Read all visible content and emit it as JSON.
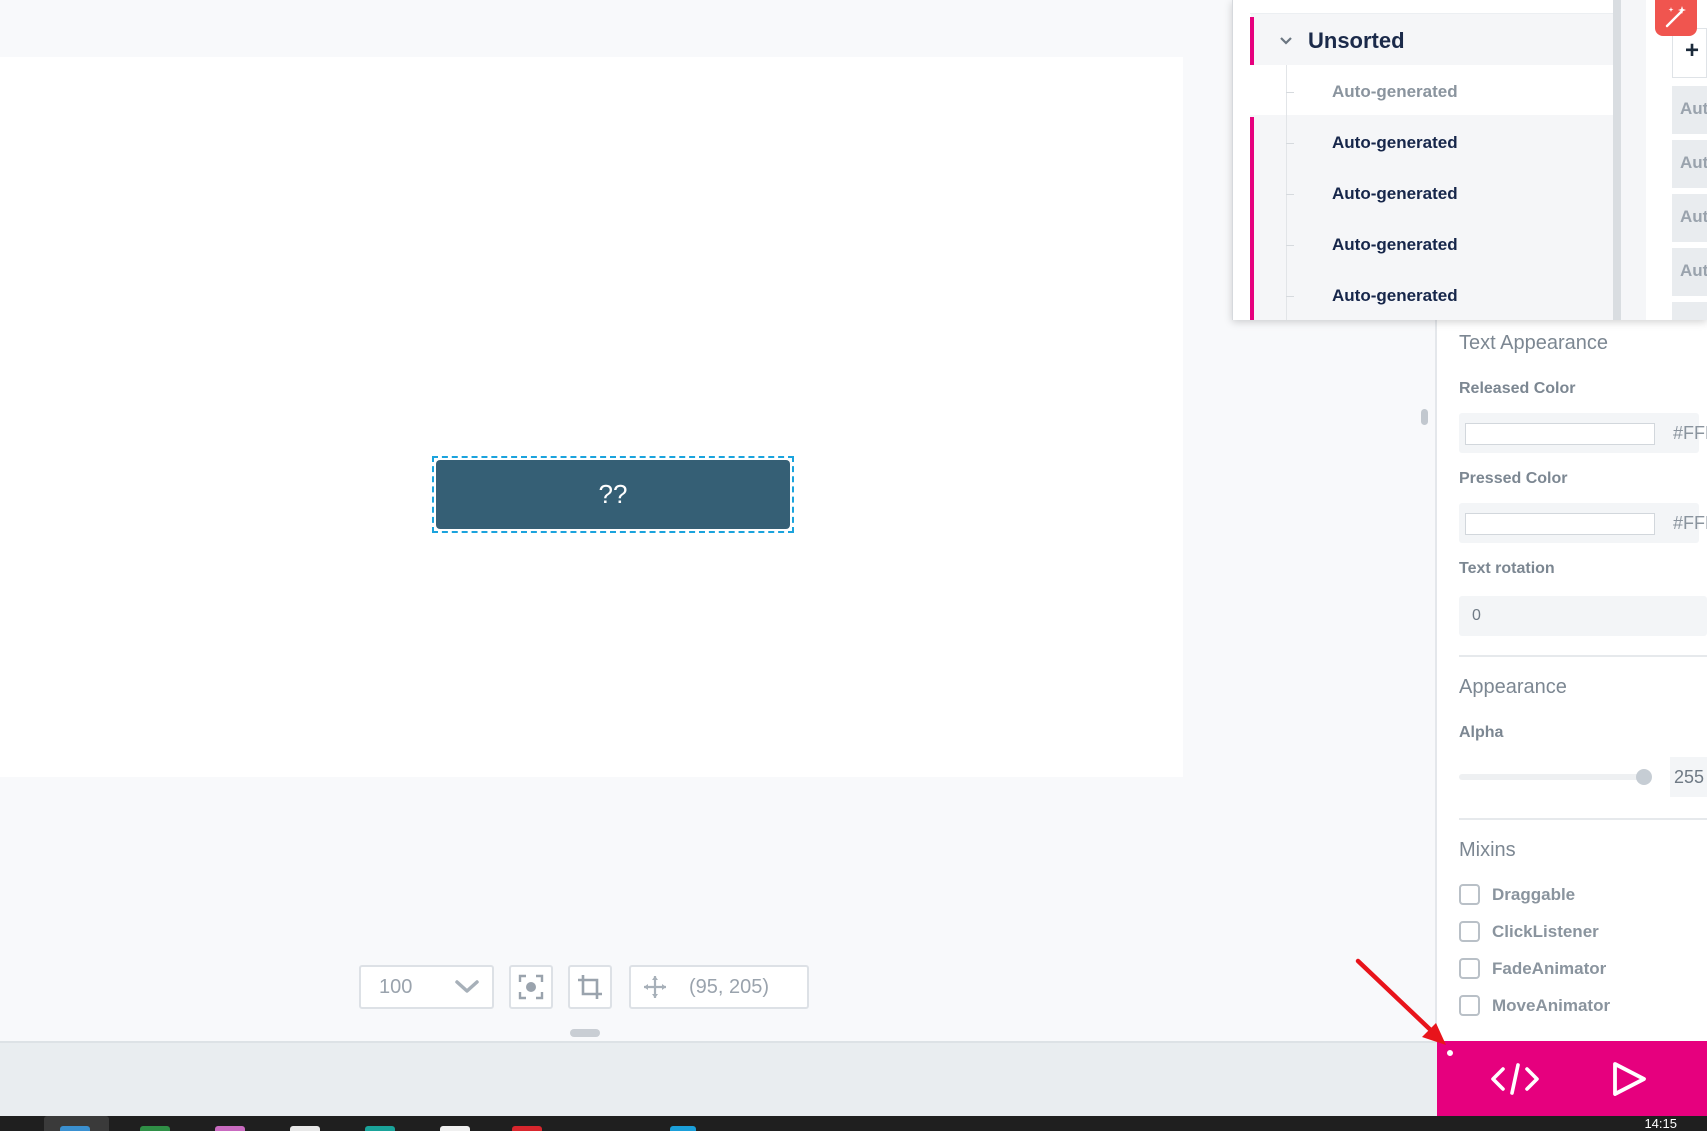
{
  "canvas": {
    "widget_text": "??",
    "zoom_value": "100",
    "coordinates": "(95, 205)"
  },
  "tree": {
    "group_label": "Unsorted",
    "items": [
      {
        "label": "Auto-generated",
        "active": false
      },
      {
        "label": "Auto-generated",
        "active": true
      },
      {
        "label": "Auto-generated",
        "active": true
      },
      {
        "label": "Auto-generated",
        "active": true
      },
      {
        "label": "Auto-generated",
        "active": true
      }
    ],
    "right_column": [
      "Aut",
      "Aut",
      "Aut",
      "Aut"
    ]
  },
  "properties": {
    "text_appearance_title": "Text Appearance",
    "released_color_label": "Released Color",
    "released_color_value": "#FFF",
    "pressed_color_label": "Pressed Color",
    "pressed_color_value": "#FFF",
    "text_rotation_label": "Text rotation",
    "text_rotation_value": "0",
    "appearance_title": "Appearance",
    "alpha_label": "Alpha",
    "alpha_value": "255",
    "mixins_title": "Mixins",
    "mixins": [
      "Draggable",
      "ClickListener",
      "FadeAnimator",
      "MoveAnimator"
    ]
  },
  "actions": {
    "code_icon": "code-icon",
    "run_icon": "play-icon"
  },
  "taskbar": {
    "clock": "14:15"
  },
  "colors": {
    "accent": "#e6007e",
    "widget_fill": "#355f75",
    "selection": "#1aa3dd",
    "annotation": "#e8141b"
  }
}
